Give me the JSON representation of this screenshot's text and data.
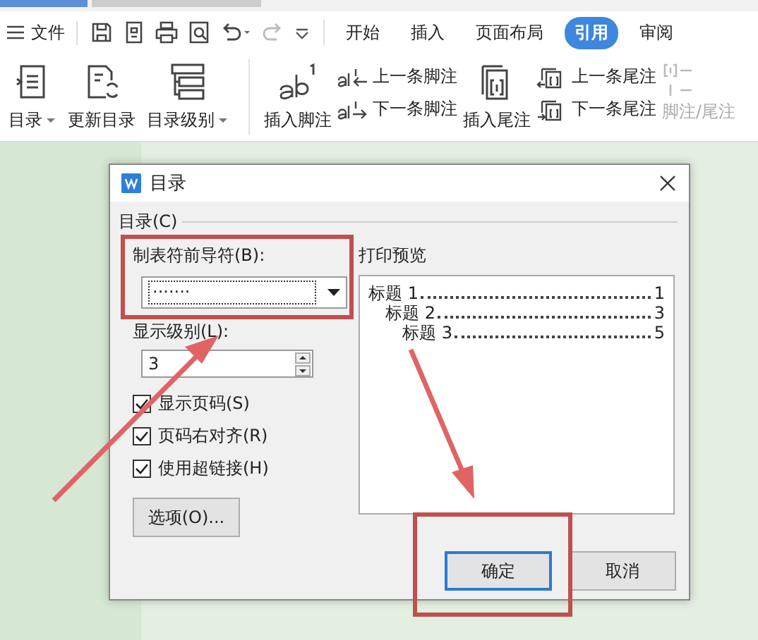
{
  "menu": {
    "file": "文件",
    "tabs": [
      {
        "label": "开始",
        "selected": false
      },
      {
        "label": "插入",
        "selected": false
      },
      {
        "label": "页面布局",
        "selected": false
      },
      {
        "label": "引用",
        "selected": true
      },
      {
        "label": "审阅",
        "selected": false
      }
    ]
  },
  "ribbon": [
    {
      "kind": "large",
      "label": "目录",
      "dropdown": true
    },
    {
      "kind": "large",
      "label": "更新目录",
      "dropdown": false
    },
    {
      "kind": "large",
      "label": "目录级别",
      "dropdown": true
    },
    {
      "kind": "large",
      "label": "插入脚注",
      "dropdown": false
    },
    {
      "kind": "pair",
      "items": [
        "上一条脚注",
        "下一条脚注"
      ]
    },
    {
      "kind": "large",
      "label": "插入尾注",
      "dropdown": false
    },
    {
      "kind": "pair",
      "items": [
        "上一条尾注",
        "下一条尾注"
      ]
    },
    {
      "kind": "disabled",
      "label": "脚注/尾注"
    }
  ],
  "dialog": {
    "title": "目录",
    "group": "目录(C)",
    "leader_label": "制表符前导符(B):",
    "leader_value": "·······",
    "level_label": "显示级别(L):",
    "level_value": "3",
    "options": [
      {
        "label": "显示页码(S)",
        "checked": true
      },
      {
        "label": "页码右对齐(R)",
        "checked": true
      },
      {
        "label": "使用超链接(H)",
        "checked": true
      }
    ],
    "options_button": "选项(O)...",
    "preview_label": "打印预览",
    "preview": [
      {
        "title": "标题 1",
        "page": "1",
        "children": [
          {
            "title": "标题 2",
            "page": "3",
            "children": [
              {
                "title": "标题 3",
                "page": "5"
              }
            ]
          }
        ]
      }
    ],
    "buttons": [
      {
        "label": "确定",
        "default": true
      },
      {
        "label": "取消",
        "default": false
      }
    ]
  }
}
